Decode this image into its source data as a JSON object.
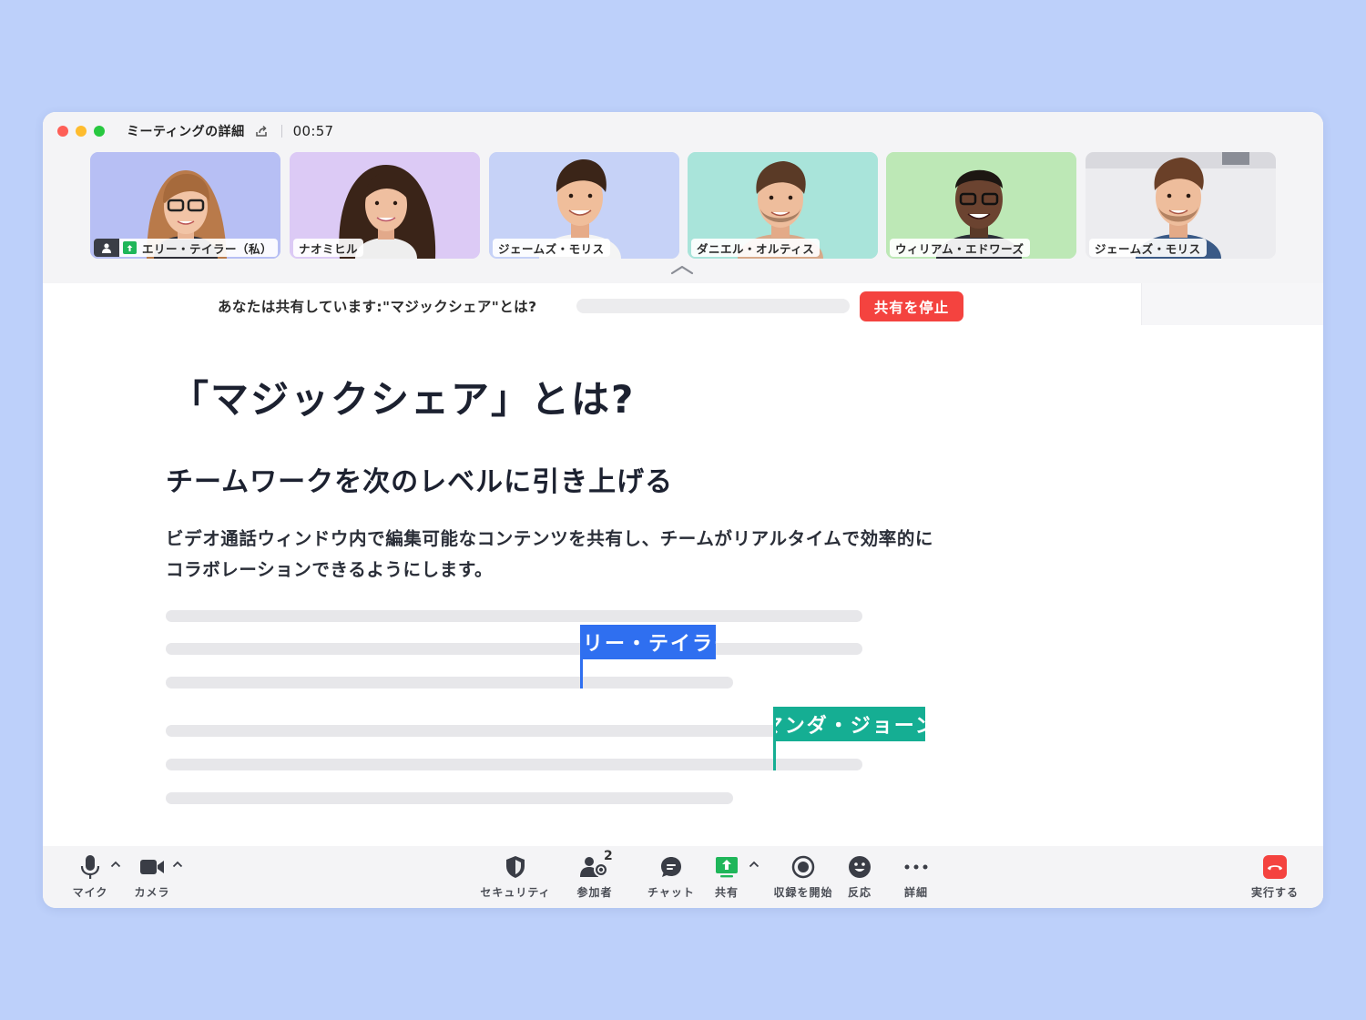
{
  "titlebar": {
    "meeting_details": "ミーティングの詳細",
    "timer": "00:57"
  },
  "participants": [
    {
      "name": "エリー・テイラー（私）",
      "bg": "#b7bff4"
    },
    {
      "name": "ナオミヒル",
      "bg": "#dccaf5"
    },
    {
      "name": "ジェームズ・モリス",
      "bg": "#c6d2f7"
    },
    {
      "name": "ダニエル・オルティス",
      "bg": "#a9e4da"
    },
    {
      "name": "ウィリアム・エドワーズ",
      "bg": "#bde8b6"
    },
    {
      "name": "ジェームズ・モリス",
      "bg": "#ececef"
    }
  ],
  "share_bar": {
    "status": "あなたは共有しています:\"マジックシェア\"とは?",
    "stop_label": "共有を停止"
  },
  "document": {
    "title": "「マジックシェア」とは?",
    "subtitle": "チームワークを次のレベルに引き上げる",
    "body_line1": "ビデオ通話ウィンドウ内で編集可能なコンテンツを共有し、チームがリアルタイムで効率的に",
    "body_line2": "コラボレーションできるようにします。",
    "cursors": [
      {
        "name": "エリー・テイラー",
        "color": "#2f6ff0"
      },
      {
        "name": "アマンダ・ジョーンズ",
        "color": "#15ae93"
      }
    ]
  },
  "toolbar": {
    "mic": "マイク",
    "camera": "カメラ",
    "security": "セキュリティ",
    "participants": "参加者",
    "participants_count": "2",
    "chat": "チャット",
    "share": "共有",
    "record": "収録を開始",
    "reactions": "反応",
    "more": "詳細",
    "end": "実行する"
  },
  "colors": {
    "accent_red": "#f4433f",
    "share_green": "#1fb65a",
    "background": "#bdd0fa"
  }
}
